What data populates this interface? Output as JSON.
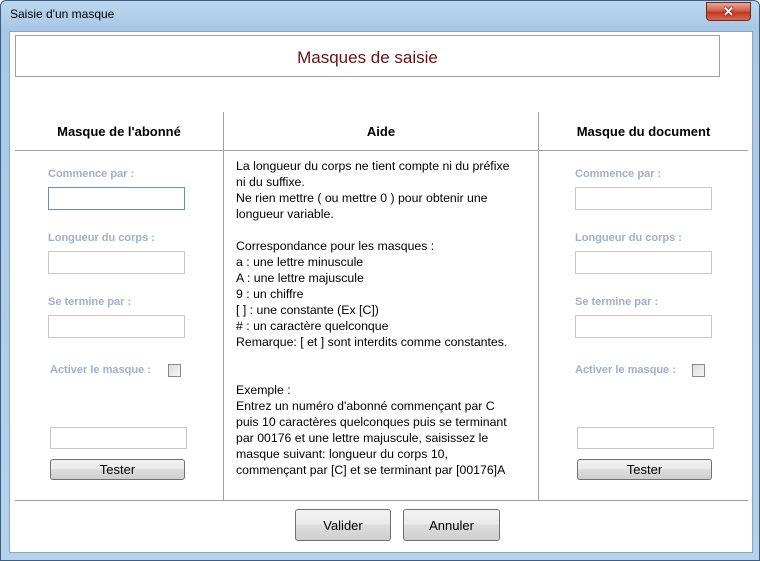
{
  "window": {
    "title": "Saisie d'un masque",
    "close_glyph": "✕"
  },
  "header": {
    "title": "Masques de saisie"
  },
  "columns": {
    "left": {
      "heading": "Masque de l'abonné",
      "starts_with_label": "Commence par :",
      "body_length_label": "Longueur du corps :",
      "ends_with_label": "Se termine par :",
      "activate_label": "Activer le masque :",
      "test_button": "Tester"
    },
    "middle": {
      "heading": "Aide",
      "help_lines_1": [
        "La longueur du corps ne tient compte ni du préfixe",
        "ni du suffixe.",
        "Ne rien mettre ( ou mettre 0 ) pour obtenir une",
        "longueur variable."
      ],
      "help_lines_2": [
        "Correspondance pour les masques :",
        "a : une lettre minuscule",
        "A : une lettre majuscule",
        "9 : un chiffre",
        "[ ] : une constante (Ex [C])",
        "# : un caractère quelconque",
        "Remarque: [ et ] sont interdits comme constantes."
      ],
      "help_lines_3": [
        "Exemple :",
        "Entrez un numéro d'abonné commençant par C",
        "puis 10 caractères quelconques puis se terminant",
        "par 00176 et une lettre majuscule, saisissez le",
        "masque suivant: longueur du corps 10,",
        "commençant par [C]  et se terminant par [00176]A"
      ]
    },
    "right": {
      "heading": "Masque du document",
      "starts_with_label": "Commence par :",
      "body_length_label": "Longueur du corps :",
      "ends_with_label": "Se termine par :",
      "activate_label": "Activer le masque :",
      "test_button": "Tester"
    }
  },
  "footer": {
    "validate_button": "Valider",
    "cancel_button": "Annuler"
  }
}
